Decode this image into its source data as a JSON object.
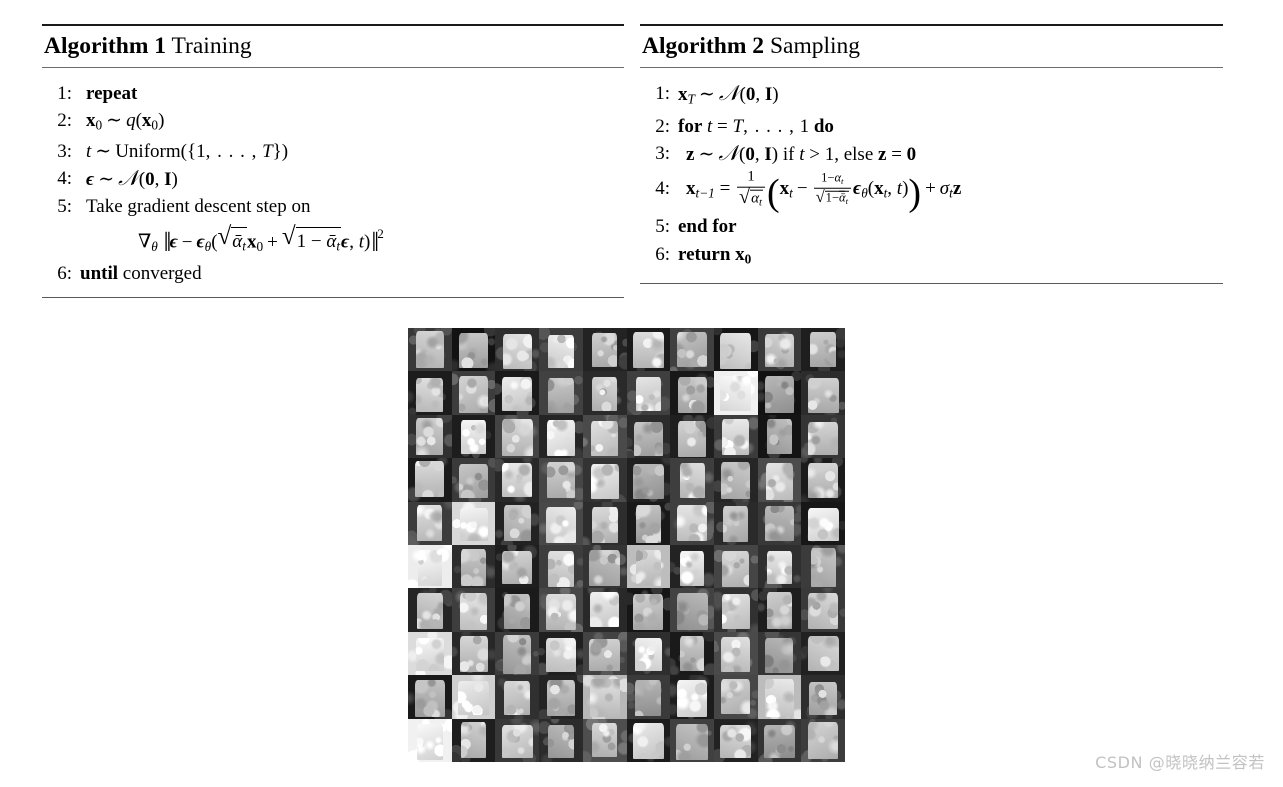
{
  "page": {
    "background": "#ffffff",
    "watermark": "CSDN @晓晓纳兰容若"
  },
  "algorithms": [
    {
      "id": "algorithm-1",
      "label": "Algorithm 1",
      "name": "Training",
      "lines": [
        {
          "num": "1:",
          "text": "repeat"
        },
        {
          "num": "2:",
          "text": "x₀ ~ q(x₀)"
        },
        {
          "num": "3:",
          "text": "t ~ Uniform({1, . . . , T})"
        },
        {
          "num": "4:",
          "text": "ε ~ N(0, I)"
        },
        {
          "num": "5:",
          "text": "Take gradient descent step on"
        },
        {
          "num": "",
          "text": "∇θ ‖ε − εθ(√(ᾱt)x₀ + √(1 − ᾱt)ε, t)‖²"
        },
        {
          "num": "6:",
          "text": "until converged"
        }
      ]
    },
    {
      "id": "algorithm-2",
      "label": "Algorithm 2",
      "name": "Sampling",
      "lines": [
        {
          "num": "1:",
          "text": "xT ~ N(0, I)"
        },
        {
          "num": "2:",
          "text": "for t = T, . . . , 1 do"
        },
        {
          "num": "3:",
          "text": "z ~ N(0, I) if t > 1, else z = 0"
        },
        {
          "num": "4:",
          "text": "xt−1 = 1/√(αt) ( xt − (1−αt)/√(1−ᾱt) εθ(xt, t) ) + σt z"
        },
        {
          "num": "5:",
          "text": "end for"
        },
        {
          "num": "6:",
          "text": "return x₀"
        }
      ]
    }
  ],
  "figure": {
    "name": "generated-samples-grid",
    "rows": 10,
    "cols": 10,
    "colorspace": "grayscale",
    "cell_backgrounds": [
      [
        "#383838",
        "#121212",
        "#2e2e2e",
        "#3c3c3c",
        "#232323",
        "#1b1b1b",
        "#404040",
        "#161616",
        "#3a3a3a",
        "#1e1e1e"
      ],
      [
        "#1c1c1c",
        "#3d3d3d",
        "#1a1a1a",
        "#414141",
        "#2a2a2a",
        "#3f3f3f",
        "#181818",
        "#f0f0f0",
        "#121212",
        "#2c2c2c"
      ],
      [
        "#303030",
        "#1d1d1d",
        "#444444",
        "#252525",
        "#4a4a4a",
        "#2b2b2b",
        "#1f1f1f",
        "#3b3b3b",
        "#141414",
        "#353535"
      ],
      [
        "#1a1a1a",
        "#3a3a3a",
        "#282828",
        "#464646",
        "#333333",
        "#202020",
        "#3e3e3e",
        "#262626",
        "#4c4c4c",
        "#1b1b1b"
      ],
      [
        "#3c3c3c",
        "#d8d8d8",
        "#222222",
        "#484848",
        "#2d2d2d",
        "#191919",
        "#3f3f3f",
        "#2a2a2a",
        "#383838",
        "#171717"
      ],
      [
        "#ededed",
        "#2c2c2c",
        "#1e1e1e",
        "#3d3d3d",
        "#343434",
        "#bdbdbd",
        "#232323",
        "#454545",
        "#2f2f2f",
        "#3b3b3b"
      ],
      [
        "#252525",
        "#3e3e3e",
        "#1b1b1b",
        "#474747",
        "#292929",
        "#161616",
        "#424242",
        "#313131",
        "#1d1d1d",
        "#393939"
      ],
      [
        "#dcdcdc",
        "#272727",
        "#3b3b3b",
        "#1f1f1f",
        "#434343",
        "#2e2e2e",
        "#1a1a1a",
        "#4a4a4a",
        "#353535",
        "#212121"
      ],
      [
        "#191919",
        "#cfcfcf",
        "#303030",
        "#242424",
        "#b7b7b7",
        "#3a3a3a",
        "#1c1c1c",
        "#464646",
        "#bcbcbc",
        "#2d2d2d"
      ],
      [
        "#f1f1f1",
        "#1e1e1e",
        "#383838",
        "#2b2b2b",
        "#4e4e4e",
        "#1b1b1b",
        "#404040",
        "#222222",
        "#343434",
        "#3d3d3d"
      ]
    ],
    "cell_garments": [
      [
        "#c9c9c9",
        "#b8b8b8",
        "#d4d4d4",
        "#e2e2e2",
        "#c0c0c0",
        "#cdcdcd",
        "#b4b4b4",
        "#d8d8d8",
        "#c6c6c6",
        "#bdbdbd"
      ],
      [
        "#d2d2d2",
        "#c4c4c4",
        "#dcdcdc",
        "#b9b9b9",
        "#c8c8c8",
        "#d6d6d6",
        "#bbbbbb",
        "#f0f0f0",
        "#a8a8a8",
        "#c1c1c1"
      ],
      [
        "#bfbfbf",
        "#e6e6e6",
        "#cbcbcb",
        "#e9e9e9",
        "#d1d1d1",
        "#b6b6b6",
        "#c3c3c3",
        "#dada da",
        "#b0b0b0",
        "#c7c7c7"
      ],
      [
        "#cccccc",
        "#b7b7b7",
        "#d9d9d9",
        "#c2c2c2",
        "#e0e0e0",
        "#ababab",
        "#cfcfcf",
        "#bcbcbc",
        "#d5d5d5",
        "#c5c5c5"
      ],
      [
        "#d0d0d0",
        "#e4e4e4",
        "#bebebe",
        "#dddddd",
        "#cacaca",
        "#b2b2b2",
        "#d7d7d7",
        "#c0c0c0",
        "#aeaeae",
        "#e7e7e7"
      ],
      [
        "#ededed",
        "#bababa",
        "#c6c6c6",
        "#d3d3d3",
        "#b5b5b5",
        "#cecece",
        "#e1e1e1",
        "#c9c9c9",
        "#dbdbdb",
        "#b9b9b9"
      ],
      [
        "#c4c4c4",
        "#d8d8d8",
        "#b3b3b3",
        "#cdcdcd",
        "#dfdfdf",
        "#c1c1c1",
        "#aaaaaa",
        "#d4d4d4",
        "#bfbfbf",
        "#cbcbcb"
      ],
      [
        "#e8e8e8",
        "#c7c7c7",
        "#b1b1b1",
        "#d6d6d6",
        "#c3c3c3",
        "#e3e3e3",
        "#bdbdbd",
        "#d0d0d0",
        "#a9a9a9",
        "#cccccc"
      ],
      [
        "#b4b4b4",
        "#dedede",
        "#c8c8c8",
        "#bbbbbb",
        "#d2d2d2",
        "#a7a7a7",
        "#e5e5e5",
        "#c5c5c5",
        "#d9d9d9",
        "#b8b8b8"
      ],
      [
        "#eaeaea",
        "#c2c2c2",
        "#d1d1d1",
        "#aeaeae",
        "#c9c9c9",
        "#dcdcdc",
        "#b6b6b6",
        "#cfcfcf",
        "#a5a5a5",
        "#c6c6c6"
      ]
    ]
  }
}
